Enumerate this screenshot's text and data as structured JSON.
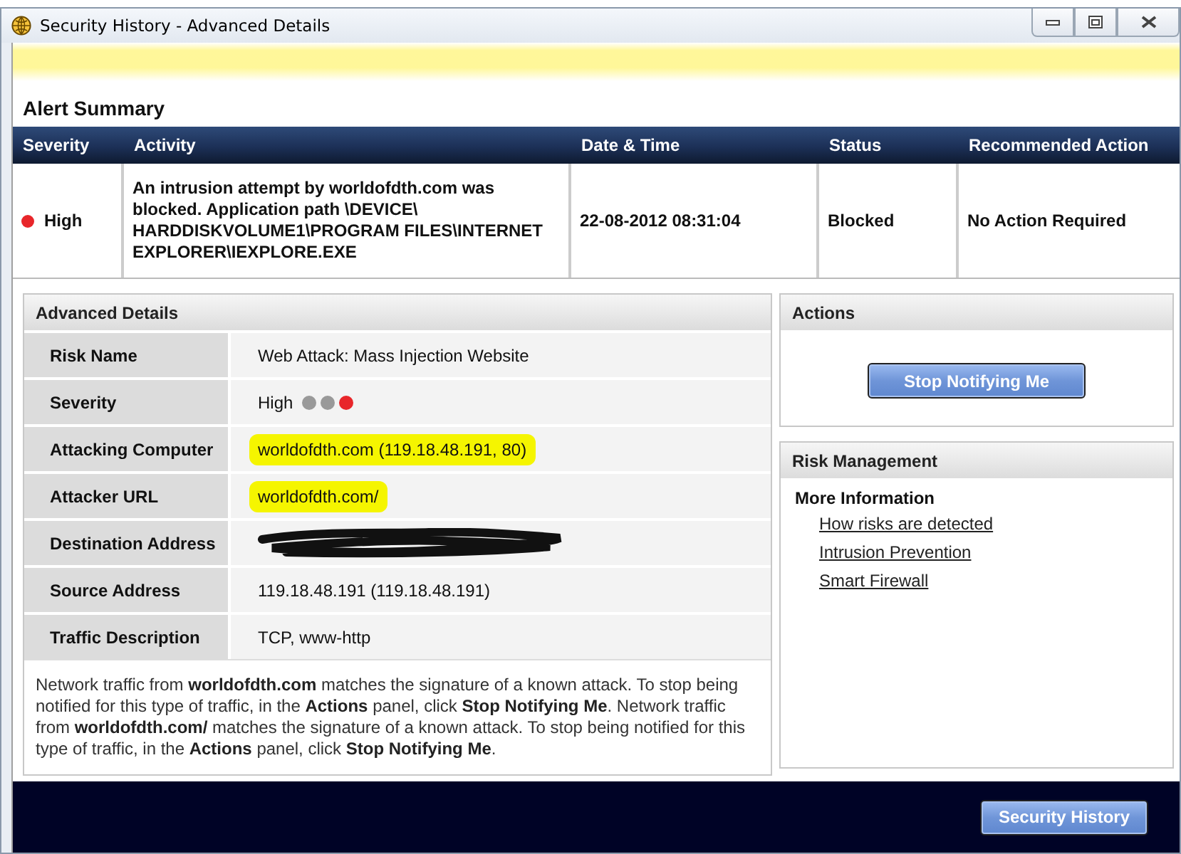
{
  "window": {
    "title": "Security History - Advanced Details"
  },
  "alert_summary": {
    "title": "Alert Summary",
    "columns": [
      "Severity",
      "Activity",
      "Date & Time",
      "Status",
      "Recommended Action"
    ],
    "rows": [
      {
        "severity": "High",
        "color": "#e8262a",
        "activity": "An intrusion attempt by worldofdth.com was blocked. Application path \\DEVICE\\ HARDDISKVOLUME1\\PROGRAM FILES\\INTERNET EXPLORER\\IEXPLORE.EXE",
        "date_time": "22-08-2012 08:31:04",
        "status": "Blocked",
        "recommended_action": "No Action Required"
      }
    ]
  },
  "advanced_details": {
    "title": "Advanced Details",
    "rows": [
      {
        "kind": "text",
        "label": "Risk Name",
        "value": "Web Attack: Mass Injection Website"
      },
      {
        "kind": "severity",
        "label": "Severity",
        "value": "High",
        "dots": [
          {
            "color": "#999999"
          },
          {
            "color": "#999999"
          },
          {
            "color": "#e8262a"
          }
        ]
      },
      {
        "kind": "text",
        "label": "Attacking Computer",
        "value": "worldofdth.com (119.18.48.191, 80)",
        "highlighted": true
      },
      {
        "kind": "text",
        "label": "Attacker URL",
        "value": "worldofdth.com/",
        "highlighted": true
      },
      {
        "kind": "redacted",
        "label": "Destination Address"
      },
      {
        "kind": "text",
        "label": "Source Address",
        "value": "119.18.48.191 (119.18.48.191)"
      },
      {
        "kind": "text",
        "label": "Traffic Description",
        "value": "TCP, www-http"
      }
    ],
    "description": "Network traffic from **worldofdth.com** matches the signature of a known attack. To stop being notified for this type of traffic, in the **Actions** panel, click **Stop Notifying Me**. Network traffic from **worldofdth.com/** matches the signature of a known attack. To stop being notified for this type of traffic, in the **Actions** panel, click **Stop Notifying Me**."
  },
  "actions": {
    "title": "Actions",
    "button": "Stop Notifying Me"
  },
  "risk_management": {
    "title": "Risk Management",
    "subtitle": "More Information",
    "links": [
      "How risks are detected",
      "Intrusion Prevention",
      "Smart Firewall"
    ]
  },
  "footer": {
    "button": "Security History"
  }
}
